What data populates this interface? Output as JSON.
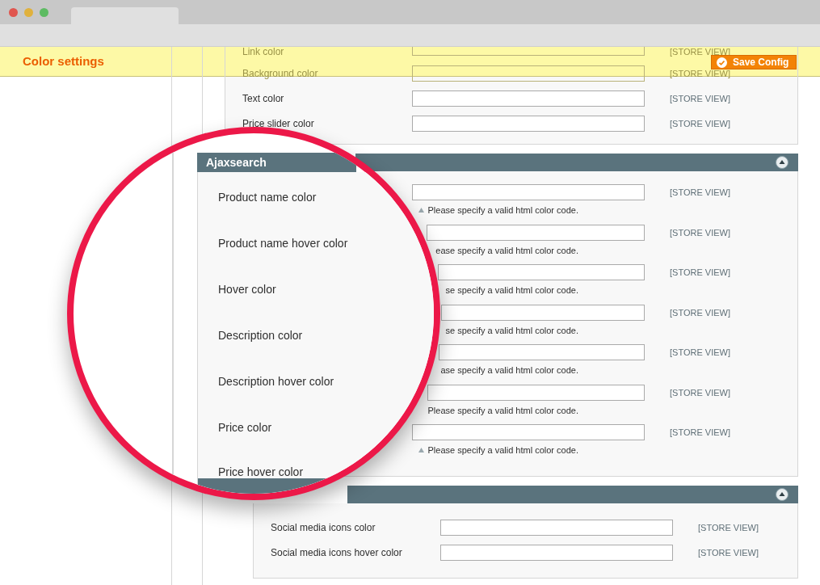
{
  "header": {
    "title": "Color settings",
    "save_button": "Save Config"
  },
  "general_fields": [
    {
      "label": "Link color",
      "scope": "[STORE VIEW]"
    },
    {
      "label": "Background color",
      "scope": "[STORE VIEW]"
    },
    {
      "label": "Text color",
      "scope": "[STORE VIEW]"
    },
    {
      "label": "Price slider color",
      "scope": "[STORE VIEW]"
    }
  ],
  "ajaxsearch": {
    "fields": [
      {
        "kind": "full",
        "scope": "[STORE VIEW]",
        "hint": "Please specify a valid html color code."
      },
      {
        "kind": "cut",
        "scope": "[STORE VIEW]",
        "hint": "ease specify a valid html color code."
      },
      {
        "kind": "cut",
        "scope": "[STORE VIEW]",
        "hint": "se specify a valid html color code."
      },
      {
        "kind": "cut",
        "scope": "[STORE VIEW]",
        "hint": "se specify a valid html color code."
      },
      {
        "kind": "cut",
        "scope": "[STORE VIEW]",
        "hint": "ase specify a valid html color code."
      },
      {
        "kind": "cut",
        "scope": "[STORE VIEW]",
        "hint": "Please specify a valid html color code."
      },
      {
        "kind": "full",
        "scope": "[STORE VIEW]",
        "hint": "Please specify a valid html color code."
      }
    ]
  },
  "social": {
    "fields": [
      {
        "label": "Social media icons color",
        "scope": "[STORE VIEW]"
      },
      {
        "label": "Social media icons hover color",
        "scope": "[STORE VIEW]"
      }
    ]
  },
  "magnifier": {
    "title": "Ajaxsearch",
    "labels": [
      "Product name color",
      "Product name hover color",
      "Hover color",
      "Description color",
      "Description hover color",
      "Price color",
      "Price hover color"
    ]
  }
}
